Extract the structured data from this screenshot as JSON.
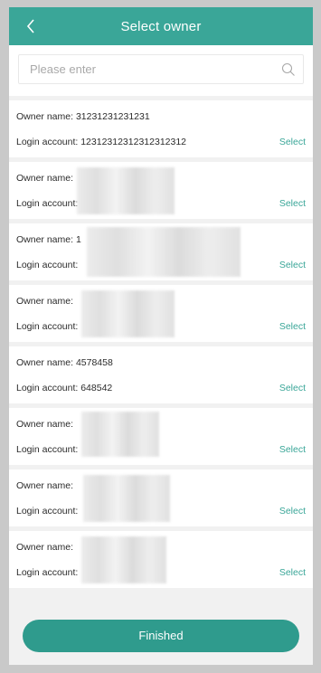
{
  "header": {
    "title": "Select owner",
    "back_icon": "chevron-left-icon"
  },
  "search": {
    "placeholder": "Please enter",
    "value": "",
    "icon": "search-icon"
  },
  "owners": [
    {
      "name_label": "Owner name: 31231231231231",
      "account_label": "Login account: 12312312312312312312",
      "select_label": "Select"
    },
    {
      "name_label": "Owner name: ",
      "account_label": "Login account:",
      "select_label": "Select"
    },
    {
      "name_label": "Owner name: 1",
      "account_label": "Login account:",
      "select_label": "Select"
    },
    {
      "name_label": "Owner name: ",
      "account_label": "Login account:",
      "select_label": "Select"
    },
    {
      "name_label": "Owner name: 4578458",
      "account_label": "Login account: 648542",
      "select_label": "Select"
    },
    {
      "name_label": "Owner name: ",
      "account_label": "Login account:",
      "select_label": "Select"
    },
    {
      "name_label": "Owner name: ",
      "account_label": "Login account:",
      "select_label": "Select"
    },
    {
      "name_label": "Owner name: ",
      "account_label": "Login account:",
      "select_label": "Select"
    }
  ],
  "footer": {
    "finish_label": "Finished"
  },
  "colors": {
    "accent": "#3aa698",
    "button": "#2f9b8d",
    "background": "#f1f1f1"
  }
}
